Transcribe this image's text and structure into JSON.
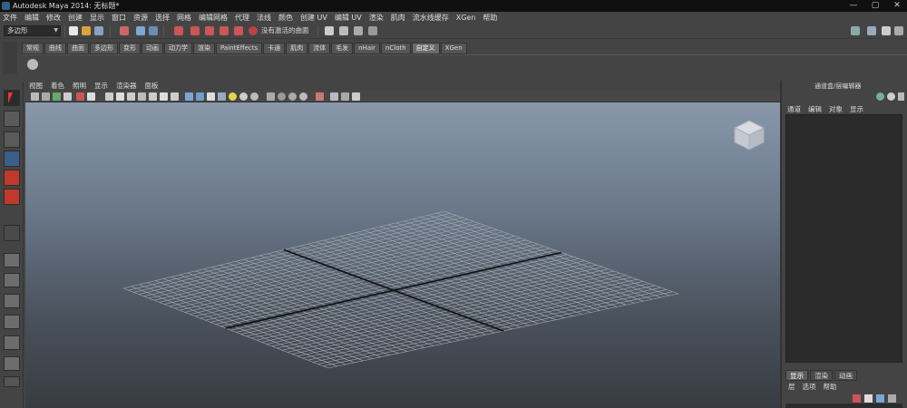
{
  "window": {
    "title": "Autodesk Maya 2014: 无标题*",
    "controls": [
      "—",
      "▢",
      "✕"
    ]
  },
  "menubar": {
    "items": [
      "文件",
      "编辑",
      "修改",
      "创建",
      "显示",
      "窗口",
      "资源",
      "选择",
      "网格",
      "编辑网格",
      "代理",
      "法线",
      "颜色",
      "创建 UV",
      "编辑 UV",
      "渲染",
      "肌肉",
      "流水线缓存",
      "XGen",
      "帮助"
    ]
  },
  "statusline": {
    "mode": "多边形",
    "live_surface": "没有激活的曲面"
  },
  "shelf": {
    "tabs": [
      "常规",
      "曲线",
      "曲面",
      "多边形",
      "变形",
      "动画",
      "动力学",
      "渲染",
      "PaintEffects",
      "卡通",
      "肌肉",
      "流体",
      "毛发",
      "nHair",
      "nCloth",
      "自定义",
      "XGen"
    ],
    "active_tab": "自定义"
  },
  "viewport": {
    "menu": [
      "视图",
      "着色",
      "照明",
      "显示",
      "渲染器",
      "面板"
    ]
  },
  "channel_box": {
    "title": "通道盒/层编辑器",
    "menu": [
      "通道",
      "编辑",
      "对象",
      "显示"
    ]
  },
  "layer_editor": {
    "tabs": [
      "显示",
      "渲染",
      "动画"
    ],
    "active_tab": "显示",
    "menu": [
      "层",
      "选项",
      "帮助"
    ]
  },
  "colors": {
    "accent_red": "#c0392b",
    "viewport_top": "#8898aa",
    "viewport_bottom": "#383c42",
    "grid": "#a6acb4",
    "grid_axis": "#111111"
  }
}
